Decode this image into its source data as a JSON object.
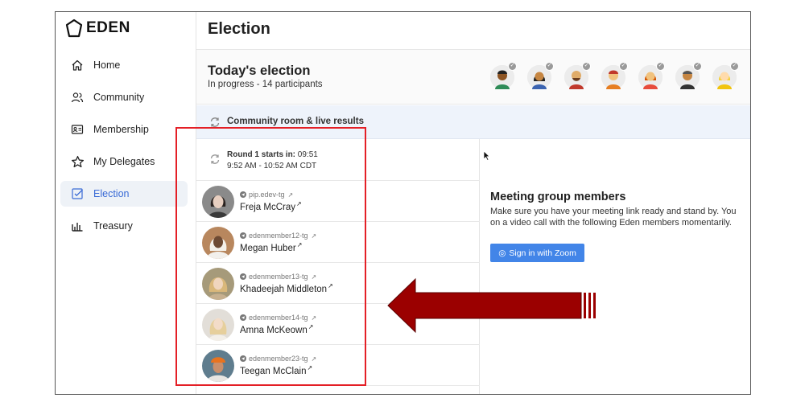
{
  "brand": {
    "name": "EDEN"
  },
  "sidebar": {
    "items": [
      {
        "label": "Home",
        "icon": "home-icon",
        "active": false
      },
      {
        "label": "Community",
        "icon": "people-icon",
        "active": false
      },
      {
        "label": "Membership",
        "icon": "id-card-icon",
        "active": false
      },
      {
        "label": "My Delegates",
        "icon": "star-icon",
        "active": false
      },
      {
        "label": "Election",
        "icon": "ballot-check-icon",
        "active": true
      },
      {
        "label": "Treasury",
        "icon": "bar-chart-icon",
        "active": false
      }
    ]
  },
  "header": {
    "title": "Election"
  },
  "today": {
    "title": "Today's election",
    "subtitle": "In progress - 14 participants"
  },
  "community_bar": {
    "label": "Community room & live results"
  },
  "round": {
    "label": "Round 1 starts in: ",
    "timer": "09:51",
    "time_range": "9:52 AM - 10:52 AM CDT"
  },
  "members": [
    {
      "handle": "pip.edev-tg",
      "name": "Freja McCray"
    },
    {
      "handle": "edenmember12-tg",
      "name": "Megan Huber"
    },
    {
      "handle": "edenmember13-tg",
      "name": "Khadeejah Middleton"
    },
    {
      "handle": "edenmember14-tg",
      "name": "Amna McKeown"
    },
    {
      "handle": "edenmember23-tg",
      "name": "Teegan McClain"
    }
  ],
  "meeting": {
    "title": "Meeting group members",
    "desc_line1": "Make sure you have your meeting link ready and stand by. You",
    "desc_line2": "on a video call with the following Eden members momentarily.",
    "zoom_button": "Sign in with Zoom"
  },
  "colors": {
    "accent": "#3a6bd6",
    "zoom_blue": "#4285e8",
    "highlight_red": "#e41f26",
    "arrow_red": "#9b0000",
    "community_bg": "#eef3fb"
  }
}
